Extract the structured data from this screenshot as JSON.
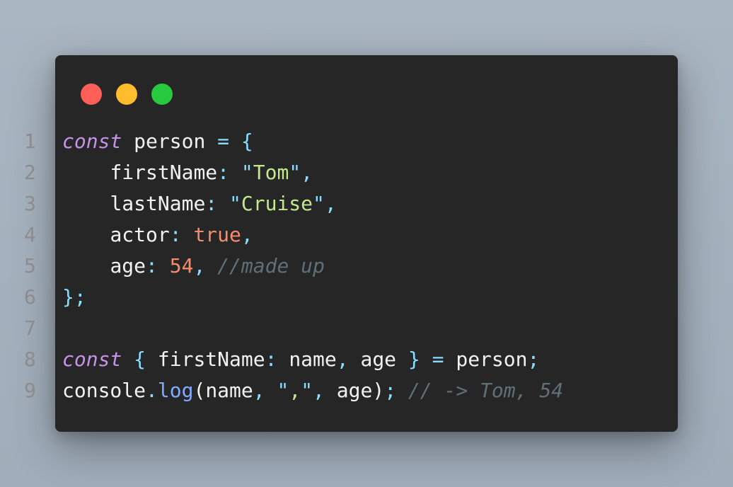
{
  "window": {
    "colors": {
      "background": "#262626",
      "close": "#ff5f56",
      "minimize": "#ffbd2e",
      "maximize": "#27c93f"
    }
  },
  "code": {
    "lines": [
      {
        "number": "1",
        "tokens": [
          {
            "text": "const",
            "type": "kw"
          },
          {
            "text": " ",
            "type": "plain"
          },
          {
            "text": "person",
            "type": "plain"
          },
          {
            "text": " ",
            "type": "plain"
          },
          {
            "text": "=",
            "type": "punc"
          },
          {
            "text": " ",
            "type": "plain"
          },
          {
            "text": "{",
            "type": "punc"
          }
        ]
      },
      {
        "number": "2",
        "tokens": [
          {
            "text": "    ",
            "type": "plain"
          },
          {
            "text": "firstName",
            "type": "plain"
          },
          {
            "text": ":",
            "type": "punc"
          },
          {
            "text": " ",
            "type": "plain"
          },
          {
            "text": "\"",
            "type": "punc"
          },
          {
            "text": "Tom",
            "type": "str"
          },
          {
            "text": "\"",
            "type": "punc"
          },
          {
            "text": ",",
            "type": "punc"
          }
        ]
      },
      {
        "number": "3",
        "tokens": [
          {
            "text": "    ",
            "type": "plain"
          },
          {
            "text": "lastName",
            "type": "plain"
          },
          {
            "text": ":",
            "type": "punc"
          },
          {
            "text": " ",
            "type": "plain"
          },
          {
            "text": "\"",
            "type": "punc"
          },
          {
            "text": "Cruise",
            "type": "str"
          },
          {
            "text": "\"",
            "type": "punc"
          },
          {
            "text": ",",
            "type": "punc"
          }
        ]
      },
      {
        "number": "4",
        "tokens": [
          {
            "text": "    ",
            "type": "plain"
          },
          {
            "text": "actor",
            "type": "plain"
          },
          {
            "text": ":",
            "type": "punc"
          },
          {
            "text": " ",
            "type": "plain"
          },
          {
            "text": "true",
            "type": "bool"
          },
          {
            "text": ",",
            "type": "punc"
          }
        ]
      },
      {
        "number": "5",
        "tokens": [
          {
            "text": "    ",
            "type": "plain"
          },
          {
            "text": "age",
            "type": "plain"
          },
          {
            "text": ":",
            "type": "punc"
          },
          {
            "text": " ",
            "type": "plain"
          },
          {
            "text": "54",
            "type": "num"
          },
          {
            "text": ",",
            "type": "punc"
          },
          {
            "text": " ",
            "type": "plain"
          },
          {
            "text": "//made up",
            "type": "comment"
          }
        ]
      },
      {
        "number": "6",
        "tokens": [
          {
            "text": "};",
            "type": "punc"
          }
        ]
      },
      {
        "number": "7",
        "tokens": []
      },
      {
        "number": "8",
        "tokens": [
          {
            "text": "const",
            "type": "kw"
          },
          {
            "text": " ",
            "type": "plain"
          },
          {
            "text": "{",
            "type": "punc"
          },
          {
            "text": " ",
            "type": "plain"
          },
          {
            "text": "firstName",
            "type": "plain"
          },
          {
            "text": ":",
            "type": "punc"
          },
          {
            "text": " ",
            "type": "plain"
          },
          {
            "text": "name",
            "type": "plain"
          },
          {
            "text": ",",
            "type": "punc"
          },
          {
            "text": " ",
            "type": "plain"
          },
          {
            "text": "age",
            "type": "plain"
          },
          {
            "text": " ",
            "type": "plain"
          },
          {
            "text": "}",
            "type": "punc"
          },
          {
            "text": " ",
            "type": "plain"
          },
          {
            "text": "=",
            "type": "punc"
          },
          {
            "text": " ",
            "type": "plain"
          },
          {
            "text": "person",
            "type": "plain"
          },
          {
            "text": ";",
            "type": "punc"
          }
        ]
      },
      {
        "number": "9",
        "tokens": [
          {
            "text": "console",
            "type": "plain"
          },
          {
            "text": ".",
            "type": "punc"
          },
          {
            "text": "log",
            "type": "fn"
          },
          {
            "text": "(",
            "type": "plain"
          },
          {
            "text": "name",
            "type": "plain"
          },
          {
            "text": ",",
            "type": "punc"
          },
          {
            "text": " ",
            "type": "plain"
          },
          {
            "text": "\"",
            "type": "punc"
          },
          {
            "text": ",",
            "type": "str"
          },
          {
            "text": "\"",
            "type": "punc"
          },
          {
            "text": ",",
            "type": "punc"
          },
          {
            "text": " ",
            "type": "plain"
          },
          {
            "text": "age",
            "type": "plain"
          },
          {
            "text": ")",
            "type": "plain"
          },
          {
            "text": ";",
            "type": "punc"
          },
          {
            "text": " ",
            "type": "plain"
          },
          {
            "text": "// -> Tom, 54",
            "type": "comment"
          }
        ]
      }
    ]
  }
}
